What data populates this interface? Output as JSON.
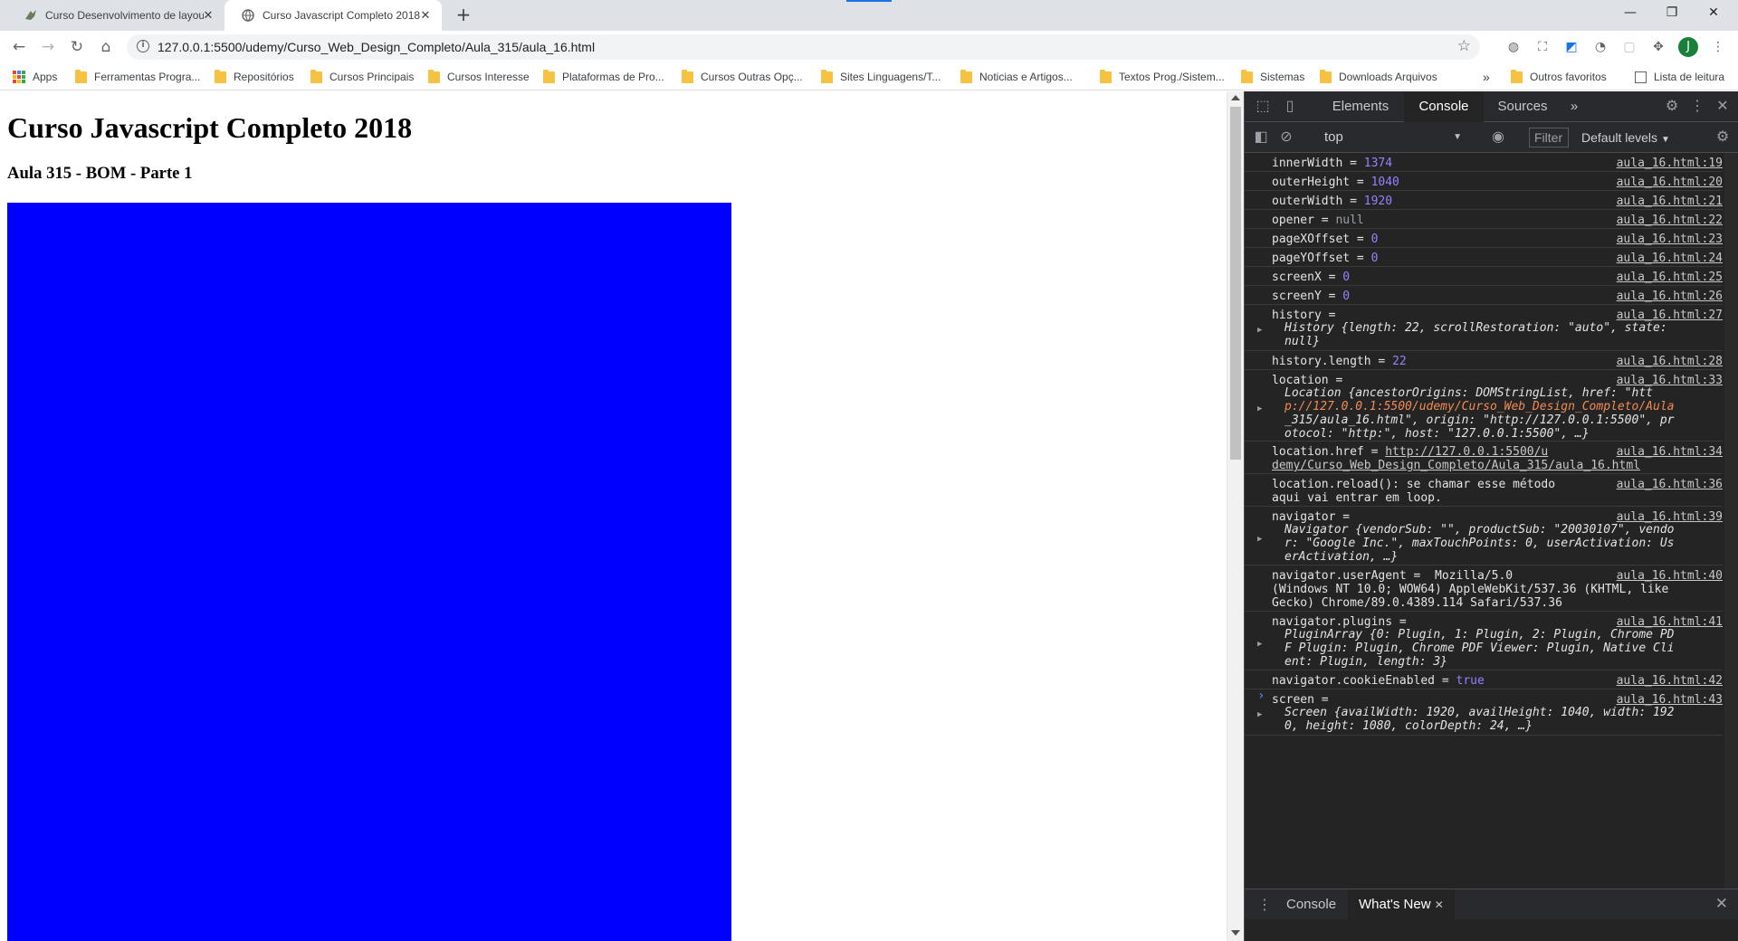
{
  "browser": {
    "tabs": [
      {
        "title": "Curso Desenvolvimento de layou",
        "active": false
      },
      {
        "title": "Curso Javascript Completo 2018",
        "active": true
      }
    ],
    "url": "127.0.0.1:5500/udemy/Curso_Web_Design_Completo/Aula_315/aula_16.html",
    "profile_initial": "J",
    "bookmarks": [
      {
        "label": "Apps",
        "icon": "apps-icon"
      },
      {
        "label": "Ferramentas Progra...",
        "icon": "folder-icon"
      },
      {
        "label": "Repositórios",
        "icon": "folder-icon"
      },
      {
        "label": "Cursos Principais",
        "icon": "folder-icon"
      },
      {
        "label": "Cursos Interesse",
        "icon": "folder-icon"
      },
      {
        "label": "Plataformas de Pro...",
        "icon": "folder-icon"
      },
      {
        "label": "Cursos Outras Opç...",
        "icon": "folder-icon"
      },
      {
        "label": "Sites Linguagens/T...",
        "icon": "folder-icon"
      },
      {
        "label": "Noticias e Artigos...",
        "icon": "folder-icon"
      },
      {
        "label": "Textos Prog./Sistem...",
        "icon": "folder-icon"
      },
      {
        "label": "Sistemas",
        "icon": "folder-icon"
      },
      {
        "label": "Downloads Arquivos",
        "icon": "folder-icon"
      }
    ],
    "bookmarks_overflow": "»",
    "other_bookmarks": "Outros favoritos",
    "reading_list": "Lista de leitura"
  },
  "page": {
    "title": "Curso Javascript Completo 2018",
    "subtitle": "Aula 315 - BOM - Parte 1",
    "box_color": "#0000ff"
  },
  "devtools": {
    "tabs": [
      "Elements",
      "Console",
      "Sources"
    ],
    "active_tab": "Console",
    "more_tabs": "»",
    "context": "top",
    "filter_placeholder": "Filter",
    "levels": "Default levels",
    "messages": [
      {
        "text": "innerWidth = ",
        "value": "1374",
        "vtype": "num",
        "src": "aula_16.html:19"
      },
      {
        "text": "outerHeight = ",
        "value": "1040",
        "vtype": "num",
        "src": "aula_16.html:20"
      },
      {
        "text": "outerWidth = ",
        "value": "1920",
        "vtype": "num",
        "src": "aula_16.html:21"
      },
      {
        "text": "opener = ",
        "value": "null",
        "vtype": "nul",
        "src": "aula_16.html:22"
      },
      {
        "text": "pageXOffset = ",
        "value": "0",
        "vtype": "num",
        "src": "aula_16.html:23"
      },
      {
        "text": "pageYOffset = ",
        "value": "0",
        "vtype": "num",
        "src": "aula_16.html:24"
      },
      {
        "text": "screenX = ",
        "value": "0",
        "vtype": "num",
        "src": "aula_16.html:25"
      },
      {
        "text": "screenY = ",
        "value": "0",
        "vtype": "num",
        "src": "aula_16.html:26"
      },
      {
        "text": "history = ",
        "src": "aula_16.html:27",
        "object_lines": [
          "History {length: 22, scrollRestoration: \"auto\", state:",
          "null}"
        ]
      },
      {
        "text": "history.length = ",
        "value": "22",
        "vtype": "num",
        "src": "aula_16.html:28"
      },
      {
        "text": "location = ",
        "src": "aula_16.html:33",
        "object_lines": [
          "Location {ancestorOrigins: DOMStringList, href: \"htt",
          "p://127.0.0.1:5500/udemy/Curso_Web_Design_Completo/Aula",
          "_315/aula_16.html\", origin: \"http://127.0.0.1:5500\", pr",
          "otocol: \"http:\", host: \"127.0.0.1:5500\", …}"
        ]
      },
      {
        "text": "location.href = ",
        "src": "aula_16.html:34",
        "link_lines": [
          "http://127.0.0.1:5500/u",
          "demy/Curso_Web_Design_Completo/Aula_315/aula_16.html"
        ]
      },
      {
        "text": "location.reload(): se chamar esse método",
        "src": "aula_16.html:36",
        "cont_lines": [
          "aqui vai entrar em loop."
        ]
      },
      {
        "text": "navigator = ",
        "src": "aula_16.html:39",
        "object_lines": [
          "Navigator {vendorSub: \"\", productSub: \"20030107\", vendo",
          "r: \"Google Inc.\", maxTouchPoints: 0, userActivation: Us",
          "erActivation, …}"
        ]
      },
      {
        "text": "navigator.userAgent =  Mozilla/5.0",
        "src": "aula_16.html:40",
        "cont_lines": [
          "(Windows NT 10.0; WOW64) AppleWebKit/537.36 (KHTML, like",
          "Gecko) Chrome/89.0.4389.114 Safari/537.36"
        ]
      },
      {
        "text": "navigator.plugins = ",
        "src": "aula_16.html:41",
        "object_lines": [
          "PluginArray {0: Plugin, 1: Plugin, 2: Plugin, Chrome PD",
          "F Plugin: Plugin, Chrome PDF Viewer: Plugin, Native Cli",
          "ent: Plugin, length: 3}"
        ]
      },
      {
        "text": "navigator.cookieEnabled = ",
        "value": "true",
        "vtype": "kw",
        "src": "aula_16.html:42"
      },
      {
        "text": "screen = ",
        "src": "aula_16.html:43",
        "object_lines": [
          "Screen {availWidth: 1920, availHeight: 1040, width: 192",
          "0, height: 1080, colorDepth: 24, …}"
        ]
      }
    ],
    "prompt": "›",
    "drawer_tabs": [
      "Console",
      "What's New"
    ],
    "drawer_active": "What's New"
  }
}
